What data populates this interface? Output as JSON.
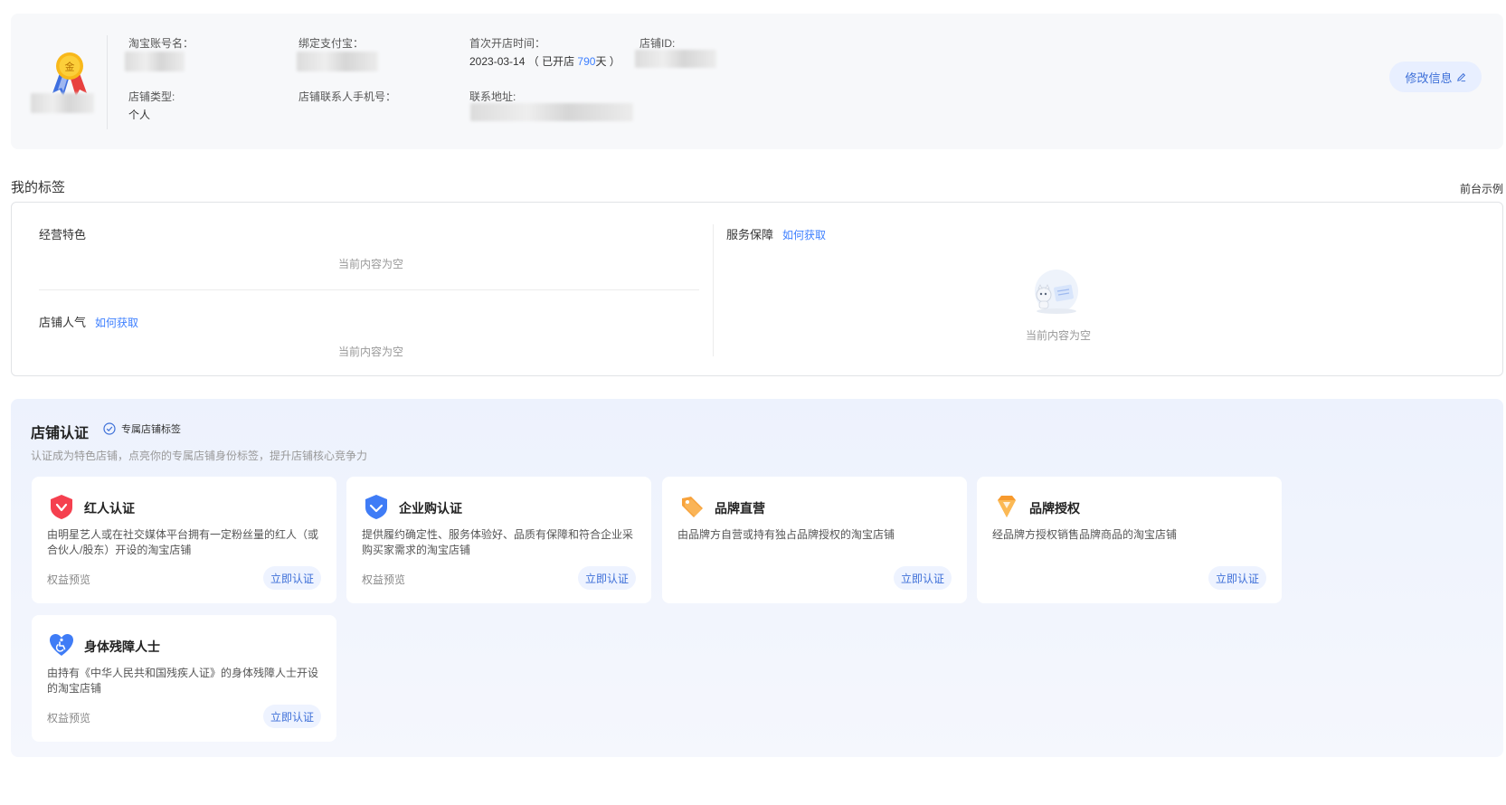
{
  "shop_info": {
    "level_badge": "金",
    "fields": {
      "taobao_account": {
        "label": "淘宝账号名："
      },
      "alipay": {
        "label": "绑定支付宝："
      },
      "open_time": {
        "label": "首次开店时间：",
        "date": "2023-03-14",
        "open_prefix": "（ 已开店 ",
        "open_days": "790",
        "open_suffix": "天 ）"
      },
      "shop_id": {
        "label": "店铺ID:"
      },
      "shop_type": {
        "label": "店铺类型:",
        "value": "个人"
      },
      "contact_phone": {
        "label": "店铺联系人手机号："
      },
      "address": {
        "label": "联系地址:"
      }
    },
    "edit_label": "修改信息"
  },
  "tags": {
    "title": "我的标签",
    "front_example": "前台示例",
    "business_features": {
      "title": "经营特色",
      "empty": "当前内容为空"
    },
    "shop_popularity": {
      "title": "店铺人气",
      "how_link": "如何获取",
      "empty": "当前内容为空"
    },
    "service_guarantee": {
      "title": "服务保障",
      "how_link": "如何获取",
      "empty": "当前内容为空"
    }
  },
  "certification": {
    "title": "店铺认证",
    "badge_label": "专属店铺标签",
    "description": "认证成为特色店铺，点亮你的专属店铺身份标签，提升店铺核心竞争力",
    "cards": [
      {
        "title": "红人认证",
        "desc": "由明星艺人或在社交媒体平台拥有一定粉丝量的红人（或合伙人/股东）开设的淘宝店铺",
        "preview": "权益预览",
        "button": "立即认证",
        "icon": "red-heart-check-icon",
        "color": "#f5404f"
      },
      {
        "title": "企业购认证",
        "desc": "提供履约确定性、服务体验好、品质有保障和符合企业采购买家需求的淘宝店铺",
        "preview": "权益预览",
        "button": "立即认证",
        "icon": "blue-shield-check-icon",
        "color": "#3f7cf6"
      },
      {
        "title": "品牌直营",
        "desc": "由品牌方自营或持有独占品牌授权的淘宝店铺",
        "preview": "",
        "button": "立即认证",
        "icon": "orange-tag-icon",
        "color": "#f7a23b"
      },
      {
        "title": "品牌授权",
        "desc": "经品牌方授权销售品牌商品的淘宝店铺",
        "preview": "",
        "button": "立即认证",
        "icon": "orange-diamond-icon",
        "color": "#f79a2e"
      },
      {
        "title": "身体残障人士",
        "desc": "由持有《中华人民共和国残疾人证》的身体残障人士开设的淘宝店铺",
        "preview": "权益预览",
        "button": "立即认证",
        "icon": "blue-heart-accessibility-icon",
        "color": "#3f7cf6"
      }
    ]
  }
}
